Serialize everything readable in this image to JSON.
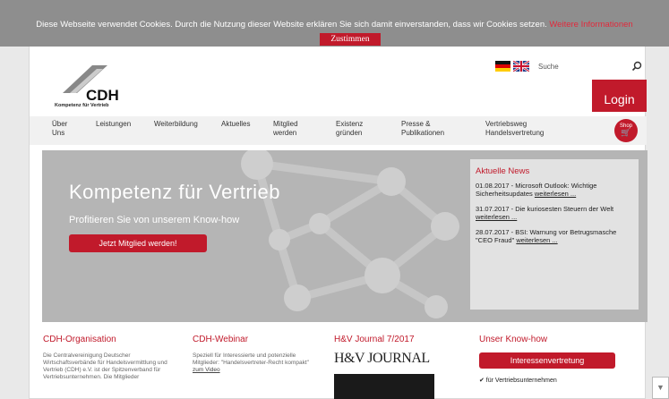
{
  "cookie": {
    "message": "Diese Webseite verwendet Cookies. Durch die Nutzung dieser Website erklären Sie sich damit einverstanden, dass wir Cookies setzen.",
    "more_label": "Weitere Informationen",
    "agree_label": "Zustimmen"
  },
  "header": {
    "logo_text": "CDH",
    "logo_tagline": "Kompetenz für Vertrieb",
    "search_placeholder": "Suche",
    "login_label": "Login"
  },
  "nav": {
    "items": [
      {
        "label": "Über\nUns"
      },
      {
        "label": "Leistungen"
      },
      {
        "label": "Weiterbildung"
      },
      {
        "label": "Aktuelles"
      },
      {
        "label": "Mitglied\nwerden"
      },
      {
        "label": "Existenz\ngründen"
      },
      {
        "label": "Presse &\nPublikationen"
      },
      {
        "label": "Vertriebsweg\nHandelsvertretung"
      }
    ],
    "shop_label": "Shop"
  },
  "hero": {
    "title": "Kompetenz für Vertrieb",
    "subtitle": "Profitieren Sie von unserem Know-how",
    "cta_label": "Jetzt Mitglied werden!"
  },
  "news": {
    "title": "Aktuelle  News",
    "items": [
      {
        "text": "01.08.2017 - Microsoft Outlook: Wichtige Sicherheitsupdates",
        "more": "weiterlesen ..."
      },
      {
        "text": "31.07.2017 - Die kuriosesten Steuern der Welt",
        "more": "weiterlesen ..."
      },
      {
        "text": "28.07.2017 - BSI: Warnung vor Betrugsmasche \"CEO Fraud\"",
        "more": "weiterlesen ..."
      }
    ]
  },
  "columns": {
    "org": {
      "title": "CDH-Organisation",
      "text": "Die Centralvereinigung Deutscher Wirtschaftsverbände für Handelsvermittlung und Vertrieb (CDH) e.V. ist der Spitzenverband für Vertriebsunternehmen. Die Mitglieder"
    },
    "webinar": {
      "title": "CDH-Webinar",
      "text": "Speziell für Interessierte und potenzielle Mitglieder: \"Handelsvertreter-Recht kompakt\"",
      "link": "zum Video"
    },
    "journal": {
      "title": "H&V  Journal  7/2017",
      "logo_text": "H&V JOURNAL"
    },
    "knowhow": {
      "title": "Unser  Know-how",
      "button_label": "Interessenvertretung",
      "item": "✔ für Vertriebsunternehmen"
    }
  },
  "colors": {
    "brand_red": "#c11a2b",
    "cookie_bar": "#8e8e8e",
    "hero_bg": "#b5b5b5"
  }
}
